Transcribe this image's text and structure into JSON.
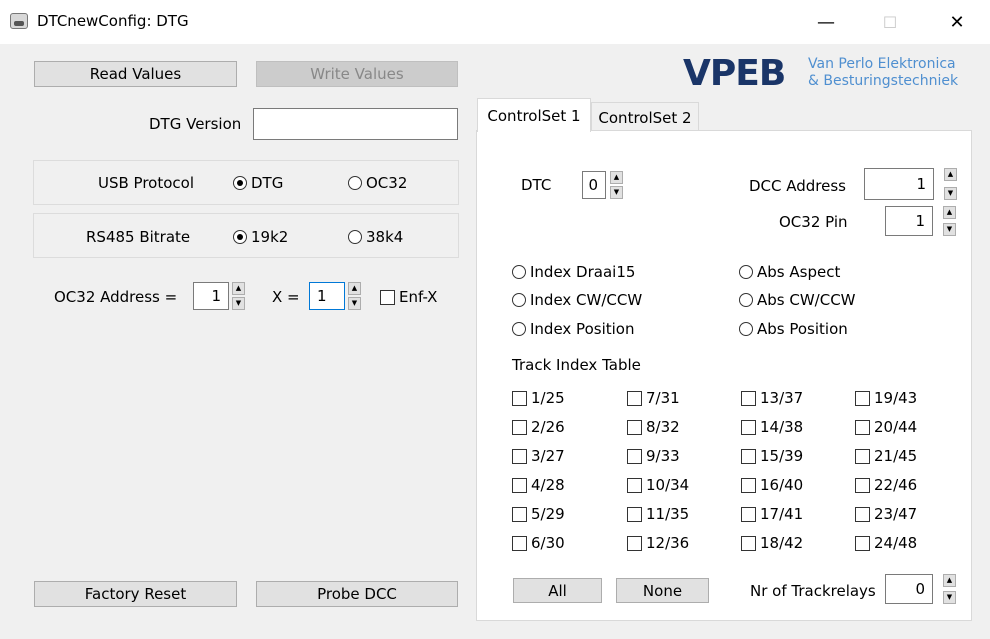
{
  "window": {
    "title": "DTCnewConfig: DTG",
    "minimize": "—",
    "maximize": "☐",
    "close": "✕"
  },
  "logo": {
    "main": "VPEB",
    "line1": "Van Perlo Elektronica",
    "line2": "& Besturingstechniek"
  },
  "left": {
    "read_values": "Read Values",
    "write_values": "Write Values",
    "dtg_version_label": "DTG Version",
    "dtg_version_value": "",
    "usb_protocol": {
      "label": "USB Protocol",
      "options": [
        "DTG",
        "OC32"
      ],
      "selected": "DTG"
    },
    "rs485_bitrate": {
      "label": "RS485 Bitrate",
      "options": [
        "19k2",
        "38k4"
      ],
      "selected": "19k2"
    },
    "oc32_address_label": "OC32 Address =",
    "oc32_address_value": "1",
    "x_label": "X =",
    "x_value": "1",
    "enf_x_label": "Enf-X",
    "factory_reset": "Factory Reset",
    "probe_dcc": "Probe DCC"
  },
  "tabs": [
    "ControlSet 1",
    "ControlSet 2"
  ],
  "controlset": {
    "dtc_label": "DTC",
    "dtc_value": "0",
    "dcc_address_label": "DCC Address",
    "dcc_address_value": "1",
    "oc32_pin_label": "OC32 Pin",
    "oc32_pin_value": "1",
    "modes_left": [
      "Index Draai15",
      "Index CW/CCW",
      "Index Position"
    ],
    "modes_right": [
      "Abs Aspect",
      "Abs CW/CCW",
      "Abs Position"
    ],
    "track_index_table_label": "Track Index Table",
    "tracks": [
      [
        "1/25",
        "2/26",
        "3/27",
        "4/28",
        "5/29",
        "6/30"
      ],
      [
        "7/31",
        "8/32",
        "9/33",
        "10/34",
        "11/35",
        "12/36"
      ],
      [
        "13/37",
        "14/38",
        "15/39",
        "16/40",
        "17/41",
        "18/42"
      ],
      [
        "19/43",
        "20/44",
        "21/45",
        "22/46",
        "23/47",
        "24/48"
      ]
    ],
    "all_button": "All",
    "none_button": "None",
    "nr_trackrelays_label": "Nr of Trackrelays",
    "nr_trackrelays_value": "0"
  },
  "icons": {
    "up": "▲",
    "down": "▼"
  }
}
